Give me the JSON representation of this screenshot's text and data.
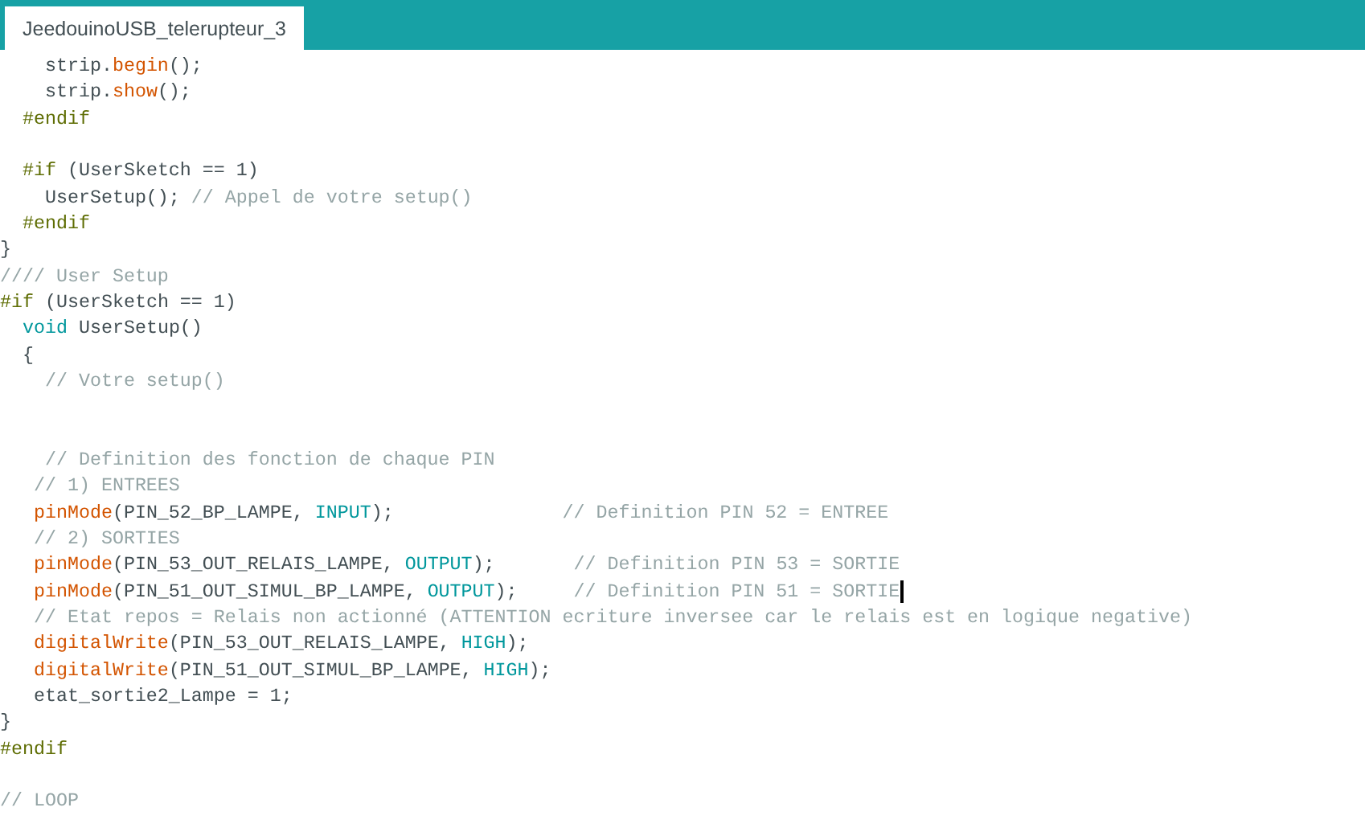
{
  "tabs": [
    {
      "label": "JeedouinoUSB_telerupteur_3",
      "selected": true
    }
  ],
  "editor": {
    "lines": [
      {
        "kind": "code",
        "caret": false,
        "segments": [
          {
            "kind": "plain",
            "text": "    strip."
          },
          {
            "kind": "function",
            "text": "begin"
          },
          {
            "kind": "plain",
            "text": "();"
          }
        ]
      },
      {
        "kind": "code",
        "caret": false,
        "segments": [
          {
            "kind": "plain",
            "text": "    strip."
          },
          {
            "kind": "function",
            "text": "show"
          },
          {
            "kind": "plain",
            "text": "();"
          }
        ]
      },
      {
        "kind": "code",
        "caret": false,
        "segments": [
          {
            "kind": "preprocessor",
            "text": "  #endif"
          }
        ]
      },
      {
        "kind": "blank"
      },
      {
        "kind": "code",
        "caret": false,
        "segments": [
          {
            "kind": "preprocessor",
            "text": "  #if"
          },
          {
            "kind": "plain",
            "text": " (UserSketch == 1)"
          }
        ]
      },
      {
        "kind": "code",
        "caret": false,
        "segments": [
          {
            "kind": "plain",
            "text": "    UserSetup(); "
          },
          {
            "kind": "comment",
            "text": "// Appel de votre setup()"
          }
        ]
      },
      {
        "kind": "code",
        "caret": false,
        "segments": [
          {
            "kind": "preprocessor",
            "text": "  #endif"
          }
        ]
      },
      {
        "kind": "code",
        "caret": false,
        "segments": [
          {
            "kind": "plain",
            "text": "}"
          }
        ]
      },
      {
        "kind": "code",
        "caret": false,
        "segments": [
          {
            "kind": "comment",
            "text": "//// User Setup"
          }
        ]
      },
      {
        "kind": "code",
        "caret": false,
        "segments": [
          {
            "kind": "preprocessor",
            "text": "#if"
          },
          {
            "kind": "plain",
            "text": " (UserSketch == 1)"
          }
        ]
      },
      {
        "kind": "code",
        "caret": false,
        "segments": [
          {
            "kind": "type",
            "text": "  void"
          },
          {
            "kind": "plain",
            "text": " UserSetup()"
          }
        ]
      },
      {
        "kind": "code",
        "caret": false,
        "segments": [
          {
            "kind": "plain",
            "text": "  {"
          }
        ]
      },
      {
        "kind": "code",
        "caret": false,
        "segments": [
          {
            "kind": "comment",
            "text": "    // Votre setup()"
          }
        ]
      },
      {
        "kind": "blank"
      },
      {
        "kind": "blank"
      },
      {
        "kind": "code",
        "caret": false,
        "segments": [
          {
            "kind": "comment",
            "text": "    // Definition des fonction de chaque PIN"
          }
        ]
      },
      {
        "kind": "code",
        "caret": false,
        "segments": [
          {
            "kind": "comment",
            "text": "   // 1) ENTREES"
          }
        ]
      },
      {
        "kind": "code",
        "caret": false,
        "segments": [
          {
            "kind": "function",
            "text": "   pinMode"
          },
          {
            "kind": "plain",
            "text": "(PIN_52_BP_LAMPE, "
          },
          {
            "kind": "constant",
            "text": "INPUT"
          },
          {
            "kind": "plain",
            "text": ");               "
          },
          {
            "kind": "comment",
            "text": "// Definition PIN 52 = ENTREE"
          }
        ]
      },
      {
        "kind": "code",
        "caret": false,
        "segments": [
          {
            "kind": "comment",
            "text": "   // 2) SORTIES"
          }
        ]
      },
      {
        "kind": "code",
        "caret": false,
        "segments": [
          {
            "kind": "function",
            "text": "   pinMode"
          },
          {
            "kind": "plain",
            "text": "(PIN_53_OUT_RELAIS_LAMPE, "
          },
          {
            "kind": "constant",
            "text": "OUTPUT"
          },
          {
            "kind": "plain",
            "text": ");       "
          },
          {
            "kind": "comment",
            "text": "// Definition PIN 53 = SORTIE"
          }
        ]
      },
      {
        "kind": "code",
        "caret": true,
        "segments": [
          {
            "kind": "function",
            "text": "   pinMode"
          },
          {
            "kind": "plain",
            "text": "(PIN_51_OUT_SIMUL_BP_LAMPE, "
          },
          {
            "kind": "constant",
            "text": "OUTPUT"
          },
          {
            "kind": "plain",
            "text": ");     "
          },
          {
            "kind": "comment",
            "text": "// Definition PIN 51 = SORTIE"
          }
        ]
      },
      {
        "kind": "code",
        "caret": false,
        "segments": [
          {
            "kind": "comment",
            "text": "   // Etat repos = Relais non actionné (ATTENTION ecriture inversee car le relais est en logique negative)"
          }
        ]
      },
      {
        "kind": "code",
        "caret": false,
        "segments": [
          {
            "kind": "function",
            "text": "   digitalWrite"
          },
          {
            "kind": "plain",
            "text": "(PIN_53_OUT_RELAIS_LAMPE, "
          },
          {
            "kind": "constant",
            "text": "HIGH"
          },
          {
            "kind": "plain",
            "text": ");"
          }
        ]
      },
      {
        "kind": "code",
        "caret": false,
        "segments": [
          {
            "kind": "function",
            "text": "   digitalWrite"
          },
          {
            "kind": "plain",
            "text": "(PIN_51_OUT_SIMUL_BP_LAMPE, "
          },
          {
            "kind": "constant",
            "text": "HIGH"
          },
          {
            "kind": "plain",
            "text": ");"
          }
        ]
      },
      {
        "kind": "code",
        "caret": false,
        "segments": [
          {
            "kind": "plain",
            "text": "   etat_sortie2_Lampe = 1;"
          }
        ]
      },
      {
        "kind": "code",
        "caret": false,
        "segments": [
          {
            "kind": "plain",
            "text": "}"
          }
        ]
      },
      {
        "kind": "code",
        "caret": false,
        "segments": [
          {
            "kind": "preprocessor",
            "text": "#endif"
          }
        ]
      },
      {
        "kind": "blank"
      },
      {
        "kind": "code",
        "caret": false,
        "segments": [
          {
            "kind": "comment",
            "text": "// LOOP"
          }
        ]
      }
    ]
  }
}
